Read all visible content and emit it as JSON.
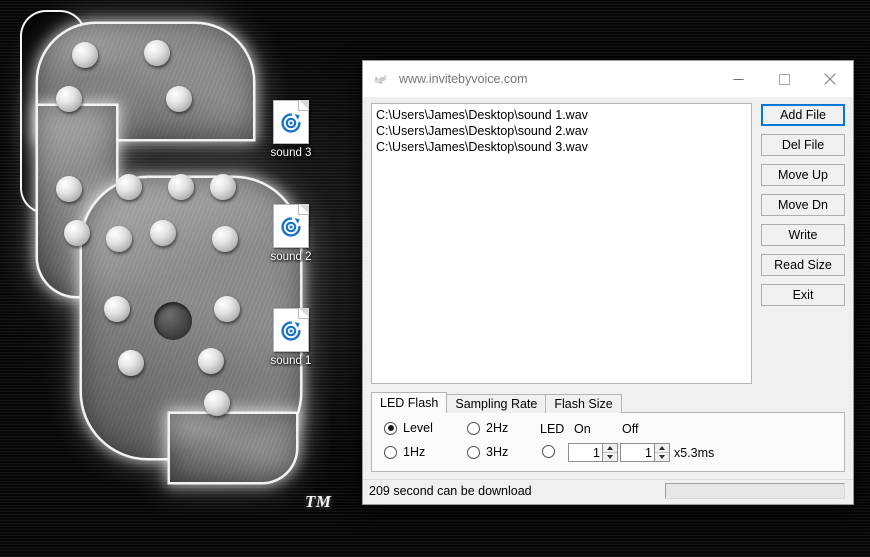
{
  "desktop": {
    "wallpaper_logo_tm": "TM",
    "icons": [
      {
        "label": "sound 3",
        "glyph": "media-disc-icon"
      },
      {
        "label": "sound 2",
        "glyph": "media-disc-icon"
      },
      {
        "label": "sound 1",
        "glyph": "media-disc-icon"
      }
    ]
  },
  "window": {
    "title": "www.invitebyvoice.com",
    "title_icon": "app-icon",
    "controls": {
      "minimize": "minimize-icon",
      "maximize": "maximize-icon",
      "close": "close-icon"
    },
    "file_list": [
      "C:\\Users\\James\\Desktop\\sound 1.wav",
      "C:\\Users\\James\\Desktop\\sound 2.wav",
      "C:\\Users\\James\\Desktop\\sound 3.wav"
    ],
    "buttons": [
      {
        "label": "Add File",
        "focused": true
      },
      {
        "label": "Del File",
        "focused": false
      },
      {
        "label": "Move Up",
        "focused": false
      },
      {
        "label": "Move Dn",
        "focused": false
      },
      {
        "label": "Write",
        "focused": false
      },
      {
        "label": "Read Size",
        "focused": false
      },
      {
        "label": "Exit",
        "focused": false
      }
    ],
    "tabs": [
      {
        "label": "LED Flash",
        "active": true
      },
      {
        "label": "Sampling Rate",
        "active": false
      },
      {
        "label": "Flash Size",
        "active": false
      }
    ],
    "led_flash": {
      "radios": [
        {
          "label": "Level",
          "checked": true
        },
        {
          "label": "1Hz",
          "checked": false
        },
        {
          "label": "2Hz",
          "checked": false
        },
        {
          "label": "3Hz",
          "checked": false
        }
      ],
      "led_label": "LED",
      "on_label": "On",
      "off_label": "Off",
      "led_radio_checked": false,
      "on_value": "1",
      "off_value": "1",
      "unit_label": "x5.3ms"
    },
    "status": {
      "message": "209 second can be download",
      "progress_percent": 0
    }
  },
  "colors": {
    "accent": "#0078d7",
    "window_face": "#f0f0f0",
    "icon_blue": "#1673c8",
    "close_hover": "#e81123"
  }
}
